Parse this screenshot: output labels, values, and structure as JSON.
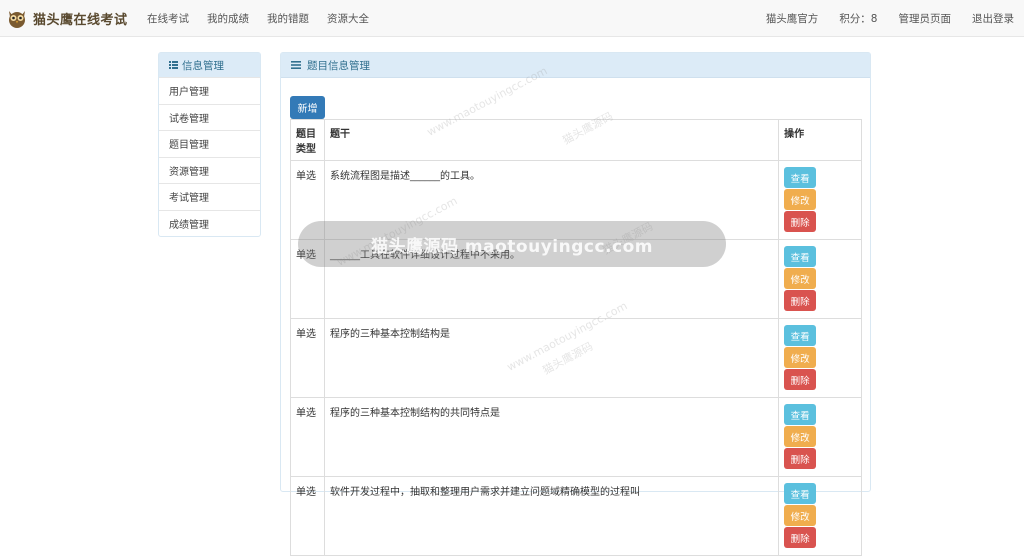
{
  "navbar": {
    "brand": "猫头鹰在线考试",
    "links": [
      "在线考试",
      "我的成绩",
      "我的错题",
      "资源大全"
    ],
    "right": {
      "official": "猫头鹰官方",
      "points": "积分：8",
      "admin": "管理员页面",
      "logout": "退出登录"
    }
  },
  "sidebar": {
    "title": "信息管理",
    "items": [
      "用户管理",
      "试卷管理",
      "题目管理",
      "资源管理",
      "考试管理",
      "成绩管理"
    ]
  },
  "panel": {
    "title": "题目信息管理",
    "new_button": "新增",
    "columns": [
      "题目类型",
      "题干",
      "操作"
    ],
    "rows": [
      {
        "type": "单选",
        "stem": "系统流程图是描述______的工具。"
      },
      {
        "type": "单选",
        "stem": "______工具在软件详细设计过程中不采用。"
      },
      {
        "type": "单选",
        "stem": "程序的三种基本控制结构是"
      },
      {
        "type": "单选",
        "stem": "程序的三种基本控制结构的共同特点是"
      },
      {
        "type": "单选",
        "stem": "软件开发过程中，抽取和整理用户需求并建立问题域精确模型的过程叫"
      }
    ],
    "ops": {
      "view": "查看",
      "edit": "修改",
      "delete": "删除"
    }
  },
  "watermark": {
    "overlay_text": "猫头鹰源码 maotouyingcc.com",
    "small_text": "www.maotouyingcc.com",
    "cn_text": "猫头鹰源码"
  }
}
